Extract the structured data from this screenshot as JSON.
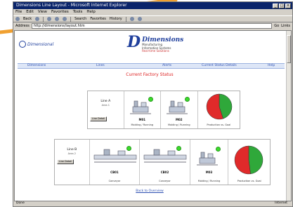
{
  "window": {
    "title": "Dimensions Line Layout - Microsoft Internet Explorer"
  },
  "menu": [
    "File",
    "Edit",
    "View",
    "Favorites",
    "Tools",
    "Help"
  ],
  "toolbar": [
    "Back",
    "Forward",
    "Stop",
    "Refresh",
    "Home",
    "Search",
    "Favorites",
    "History",
    "Mail",
    "Print"
  ],
  "address": {
    "label": "Address",
    "value": "http://dimensions/layout.htm",
    "go": "Go",
    "links": "Links"
  },
  "header": {
    "left_brand": "Dimensional",
    "logo_letter": "D",
    "brand_name": "Dimensions",
    "brand_sub1": "Manufacturing",
    "brand_sub2": "Information Systems",
    "brand_sub3": "Real-time Solutions"
  },
  "nav": [
    "Dimensions",
    "Lines",
    "Alerts",
    "Current Status Details",
    "Help"
  ],
  "page_title": "Current Factory Status",
  "row1": {
    "line_title": "Line A",
    "line_sub": "Area 1",
    "line_button": "Line Detail",
    "machines": [
      {
        "label": "M01",
        "caption": "Molding / Running"
      },
      {
        "label": "M02",
        "caption": "Molding / Running"
      }
    ],
    "chart_caption": "Production vs. Goal"
  },
  "row2": {
    "line_title": "Line B",
    "line_sub": "Area 2",
    "line_button": "Line Detail",
    "machines": [
      {
        "label": "CB01",
        "caption": "Conveyor"
      },
      {
        "label": "CB02",
        "caption": "Conveyor"
      },
      {
        "label": "M03",
        "caption": "Molding / Running"
      }
    ],
    "chart_caption": "Production vs. Goal"
  },
  "bottom_link": "Back to Overview",
  "status": {
    "left": "Done",
    "right": "Internet"
  },
  "colors": {
    "running": "#3bdc2b",
    "pie_good": "#2fa83a",
    "pie_bad": "#e02a2a",
    "title_bar": "#0a246a",
    "swoosh": "#f0a030"
  },
  "chart_data": [
    {
      "type": "pie",
      "title": "",
      "categories": [
        "good",
        "bad"
      ],
      "values": [
        45,
        55
      ],
      "colors": [
        "#2fa83a",
        "#e02a2a"
      ]
    },
    {
      "type": "pie",
      "title": "",
      "categories": [
        "good",
        "bad"
      ],
      "values": [
        48,
        52
      ],
      "colors": [
        "#2fa83a",
        "#e02a2a"
      ]
    }
  ]
}
